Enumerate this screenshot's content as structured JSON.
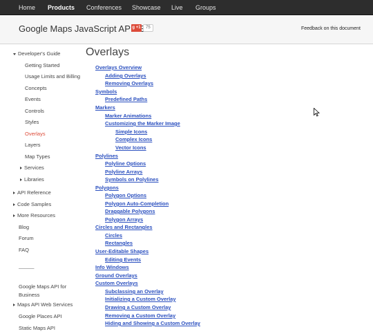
{
  "topnav": {
    "items": [
      "Home",
      "Products",
      "Conferences",
      "Showcase",
      "Live",
      "Groups"
    ]
  },
  "header": {
    "title": "Google Maps JavaScript API v3",
    "gplus_label": "g +1",
    "gplus_count": "75",
    "feedback": "Feedback on this document"
  },
  "sidebar": {
    "items": [
      "Developer's Guide",
      "Getting Started",
      "Usage Limits and Billing",
      "Concepts",
      "Events",
      "Controls",
      "Styles",
      "Overlays",
      "Layers",
      "Map Types",
      "Services",
      "Libraries",
      "API Reference",
      "Code Samples",
      "More Resources",
      "Blog",
      "Forum",
      "FAQ",
      "Google Maps API for Business",
      "Maps API Web Services",
      "Google Places API",
      "Static Maps API"
    ],
    "separator": "———"
  },
  "main": {
    "heading": "Overlays",
    "toc": [
      "Overlays Overview",
      "Adding Overlays",
      "Removing Overlays",
      "Symbols",
      "Predefined Paths",
      "Markers",
      "Marker Animations",
      "Customizing the Marker Image",
      "Simple Icons",
      "Complex Icons",
      "Vector Icons",
      "Polylines",
      "Polyline Options",
      "Polyline Arrays",
      "Symbols on Polylines",
      "Polygons",
      "Polygon Options",
      "Polygon Auto-Completion",
      "Draggable Polygons",
      "Polygon Arrays",
      "Circles and Rectangles",
      "Circles",
      "Rectangles",
      "User-Editable Shapes",
      "Editing Events",
      "Info Windows",
      "Ground Overlays",
      "Custom Overlays",
      "Subclassing an Overlay",
      "Initializing a Custom Overlay",
      "Drawing a Custom Overlay",
      "Removing a Custom Overlay",
      "Hiding and Showing a Custom Overlay"
    ]
  },
  "colors": {
    "nav_bg": "#2d2d2d",
    "link": "#2a4fbf",
    "active": "#dd4b39"
  }
}
